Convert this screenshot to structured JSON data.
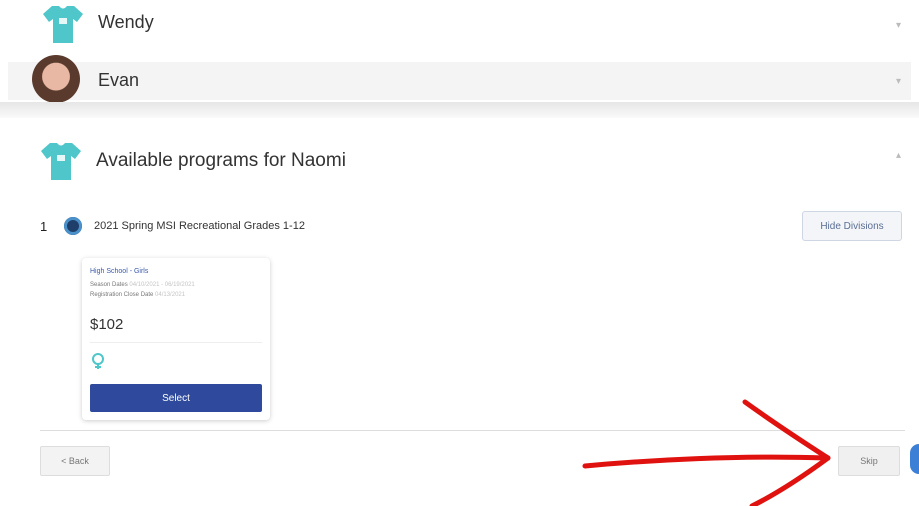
{
  "children": [
    {
      "name": "Wendy",
      "icon": "tshirt-icon"
    },
    {
      "name": "Evan",
      "icon": "avatar-photo"
    }
  ],
  "section": {
    "title": "Available programs for Naomi",
    "icon": "tshirt-icon"
  },
  "program": {
    "number": "1",
    "name": "2021 Spring MSI Recreational Grades 1-12",
    "hide_divisions_label": "Hide Divisions"
  },
  "division_card": {
    "division_name": "High School - Girls",
    "season_dates_label": "Season Dates",
    "season_dates_value": "04/10/2021 - 06/19/2021",
    "registration_close_label": "Registration Close Date",
    "registration_close_value": "04/13/2021",
    "price": "$102",
    "select_label": "Select"
  },
  "footer": {
    "back_label": "< Back",
    "skip_label": "Skip"
  },
  "colors": {
    "shirt": "#4fc6c9",
    "select_button": "#2f4a9c",
    "annotation_arrow": "#e0120f"
  }
}
